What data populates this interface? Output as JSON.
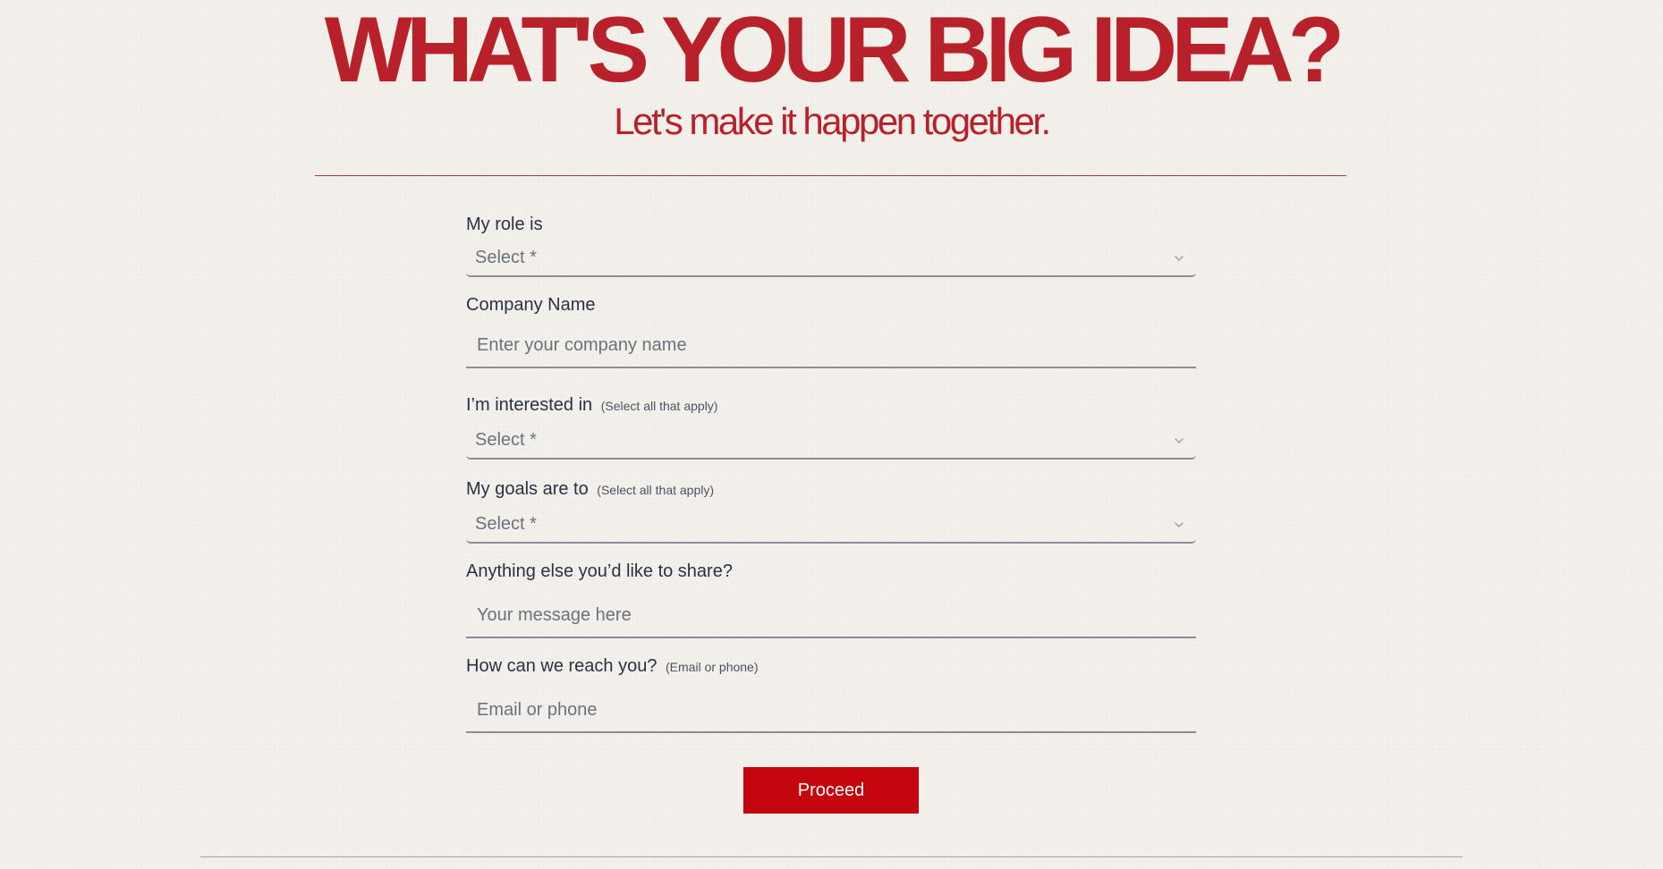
{
  "hero": {
    "title": "WHAT'S YOUR BIG IDEA?",
    "subtitle": "Let's make it happen together."
  },
  "form": {
    "role": {
      "label": "My role is",
      "value": "Select *"
    },
    "company": {
      "label": "Company Name",
      "placeholder": "Enter your company name"
    },
    "interests": {
      "label": "I’m interested in",
      "hint": "(Select all that apply)",
      "value": "Select *"
    },
    "goals": {
      "label": "My goals are to",
      "hint": "(Select all that apply)",
      "value": "Select *"
    },
    "message": {
      "label": "Anything else you’d like to share?",
      "placeholder": "Your message here"
    },
    "contact": {
      "label": "How can we reach you?",
      "hint": "(Email or phone)",
      "placeholder": "Email or phone"
    },
    "submit_label": "Proceed"
  },
  "icons": {
    "dropdown": "chevron-down-icon"
  },
  "colors": {
    "accent": "#b8202a",
    "button": "#c4060e",
    "background": "#f3f0eb",
    "text": "#2a3144"
  }
}
